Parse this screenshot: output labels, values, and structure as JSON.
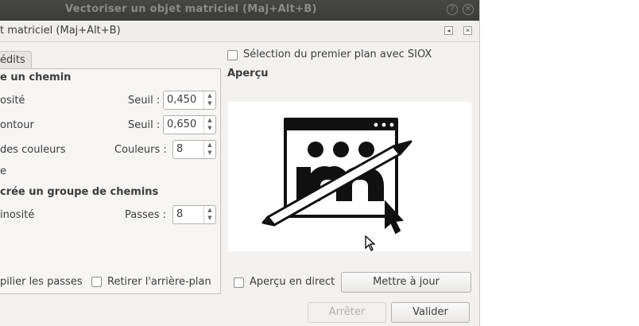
{
  "window": {
    "title": "Vectoriser un objet matriciel (Maj+Alt+B)"
  },
  "dock": {
    "title": "t matriciel (Maj+Alt+B)"
  },
  "tab": {
    "label": "édits"
  },
  "single_scan": {
    "heading": "e un chemin",
    "rows": [
      {
        "label": "osité",
        "field_label": "Seuil :",
        "value": "0,450"
      },
      {
        "label": "ontour",
        "field_label": "Seuil :",
        "value": "0,650"
      },
      {
        "label": "des couleurs",
        "field_label": "Couleurs :",
        "value": "8"
      }
    ],
    "extra_label": "e"
  },
  "multi_scan": {
    "heading": "crée un groupe de chemins",
    "row": {
      "label": "inosité",
      "field_label": "Passes :",
      "value": "8"
    }
  },
  "options": {
    "stack_label": "pilier les passes",
    "remove_bg_label": "Retirer l'arrière-plan"
  },
  "siox": {
    "label": "Sélection du premier plan avec SIOX"
  },
  "apercu": {
    "title": "Aperçu",
    "live_label": "Aperçu en direct",
    "update_button": "Mettre à jour"
  },
  "buttons": {
    "stop": "Arrêter",
    "validate": "Valider"
  },
  "colors": {
    "titlebar": "#3b3b39",
    "window_bg": "#f2f1f0"
  }
}
